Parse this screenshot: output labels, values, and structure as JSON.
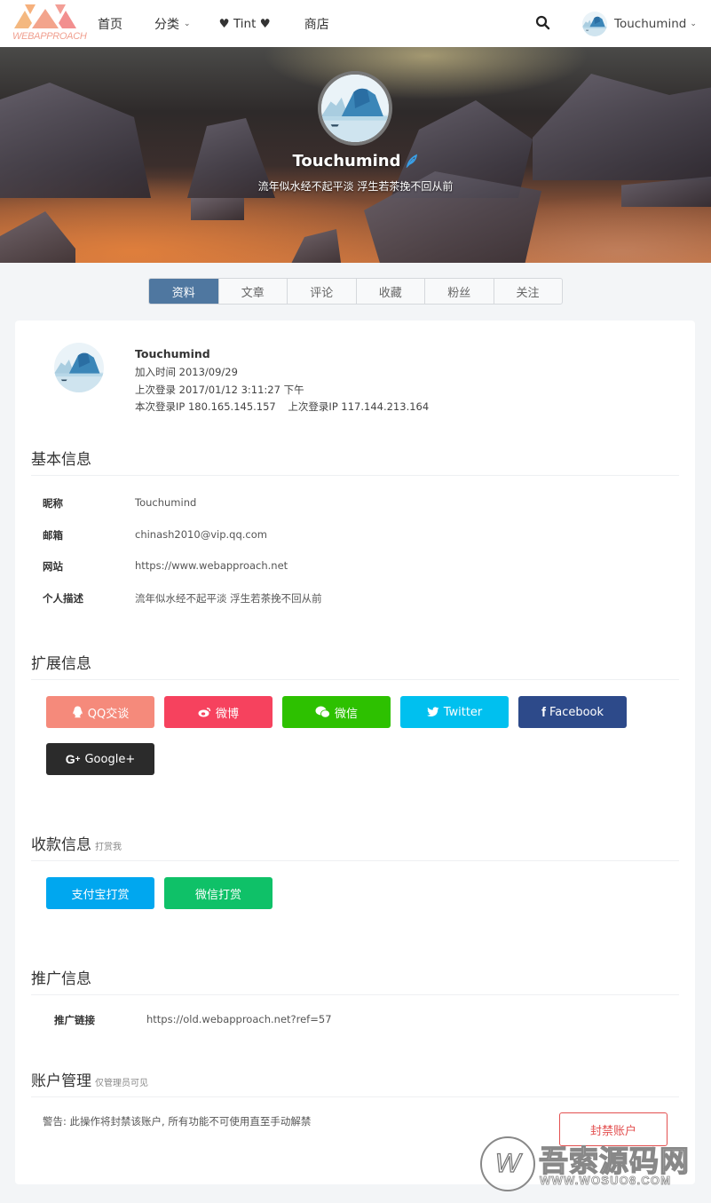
{
  "header": {
    "logo_text": "WEBAPPROACH",
    "nav": [
      {
        "label": "首页",
        "has_dropdown": false
      },
      {
        "label": "分类",
        "has_dropdown": true
      },
      {
        "label": "♥ Tint ♥",
        "has_dropdown": false
      },
      {
        "label": "商店",
        "has_dropdown": false
      }
    ],
    "search_icon": "search-icon",
    "user_name": "Touchumind",
    "chevron": "⌄"
  },
  "banner": {
    "name": "Touchumind",
    "verified_icon": "feather-icon",
    "bio": "流年似水经不起平淡 浮生若茶挽不回从前"
  },
  "tabs": [
    {
      "label": "资料",
      "active": true
    },
    {
      "label": "文章",
      "active": false
    },
    {
      "label": "评论",
      "active": false
    },
    {
      "label": "收藏",
      "active": false
    },
    {
      "label": "粉丝",
      "active": false
    },
    {
      "label": "关注",
      "active": false
    }
  ],
  "profile": {
    "name": "Touchumind",
    "join_label": "加入时间",
    "join_date": "2013/09/29",
    "last_login_label": "上次登录",
    "last_login": "2017/01/12 3:11:27 下午",
    "current_ip_label": "本次登录IP",
    "current_ip": "180.165.145.157",
    "last_ip_label": "上次登录IP",
    "last_ip": "117.144.213.164"
  },
  "basic_info": {
    "title": "基本信息",
    "fields": [
      {
        "label": "昵称",
        "value": "Touchumind"
      },
      {
        "label": "邮箱",
        "value": "chinash2010@vip.qq.com"
      },
      {
        "label": "网站",
        "value": "https://www.webapproach.net"
      },
      {
        "label": "个人描述",
        "value": "流年似水经不起平淡 浮生若茶挽不回从前"
      }
    ]
  },
  "extended_info": {
    "title": "扩展信息",
    "buttons": [
      {
        "label": "QQ交谈",
        "icon": "qq-icon",
        "color": "#f58a7b"
      },
      {
        "label": "微博",
        "icon": "weibo-icon",
        "color": "#f6425e"
      },
      {
        "label": "微信",
        "icon": "wechat-icon",
        "color": "#2dc100"
      },
      {
        "label": "Twitter",
        "icon": "twitter-icon",
        "color": "#00c0ef"
      },
      {
        "label": "Facebook",
        "icon": "facebook-icon",
        "color": "#2d4a8a"
      },
      {
        "label": "Google+",
        "icon": "google-plus-icon",
        "color": "#2b2b2b"
      }
    ]
  },
  "payment_info": {
    "title": "收款信息",
    "subtitle": "打赏我",
    "buttons": [
      {
        "label": "支付宝打赏",
        "color": "#00a7ef"
      },
      {
        "label": "微信打赏",
        "color": "#0fc168"
      }
    ]
  },
  "promotion_info": {
    "title": "推广信息",
    "link_label": "推广链接",
    "link_value": "https://old.webapproach.net?ref=57"
  },
  "account_management": {
    "title": "账户管理",
    "subtitle": "仅管理员可见",
    "warning": "警告: 此操作将封禁该账户, 所有功能不可使用直至手动解禁",
    "ban_button": "封禁账户"
  },
  "watermark": {
    "logo_letter": "W",
    "title": "吾索源码网",
    "url": "WWW.WOSUO8.COM"
  }
}
